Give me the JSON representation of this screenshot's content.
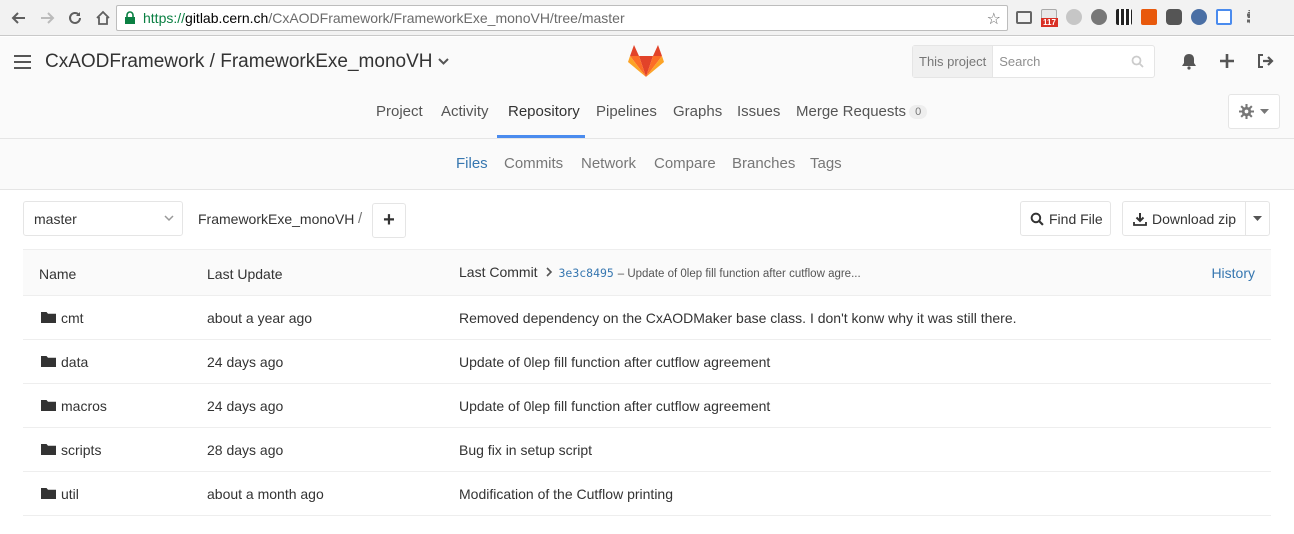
{
  "browser": {
    "url_scheme": "https://",
    "url_host": "gitlab.cern.ch",
    "url_path": "/CxAODFramework/FrameworkExe_monoVH/tree/master",
    "ext_badge": "117"
  },
  "header": {
    "project_title": "CxAODFramework / FrameworkExe_monoVH",
    "search_scope": "This project",
    "search_placeholder": "Search"
  },
  "main_nav": {
    "tabs": [
      "Project",
      "Activity",
      "Repository",
      "Pipelines",
      "Graphs",
      "Issues",
      "Merge Requests"
    ],
    "active": "Repository",
    "merge_requests_count": "0"
  },
  "sub_nav": {
    "tabs": [
      "Files",
      "Commits",
      "Network",
      "Compare",
      "Branches",
      "Tags"
    ],
    "active": "Files"
  },
  "tree": {
    "branch": "master",
    "breadcrumb": "FrameworkExe_monoVH",
    "breadcrumb_sep": "/",
    "add_label": "+",
    "find_file_label": "Find File",
    "download_label": "Download zip",
    "columns": {
      "name": "Name",
      "last_update": "Last Update",
      "last_commit": "Last Commit"
    },
    "last_commit_sha": "3e3c8495",
    "last_commit_msg": "– Update of 0lep fill function after cutflow agre...",
    "history_label": "History",
    "rows": [
      {
        "name": "cmt",
        "updated": "about a year ago",
        "message": "Removed dependency on the CxAODMaker base class. I don't konw why it was still there."
      },
      {
        "name": "data",
        "updated": "24 days ago",
        "message": "Update of 0lep fill function after cutflow agreement"
      },
      {
        "name": "macros",
        "updated": "24 days ago",
        "message": "Update of 0lep fill function after cutflow agreement"
      },
      {
        "name": "scripts",
        "updated": "28 days ago",
        "message": "Bug fix in setup script"
      },
      {
        "name": "util",
        "updated": "about a month ago",
        "message": "Modification of the Cutflow printing"
      }
    ]
  }
}
